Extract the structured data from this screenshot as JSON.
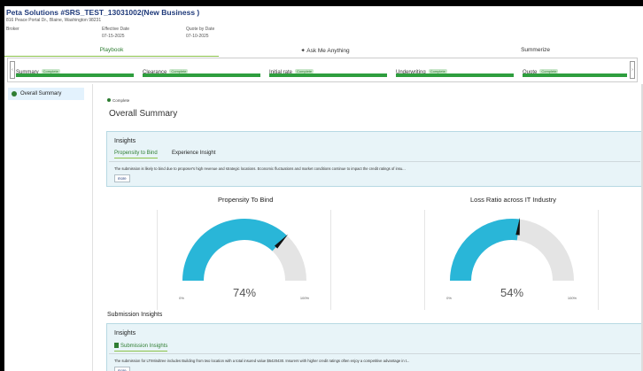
{
  "header": {
    "title": "Peta Solutions #SRS_TEST_13031002(New Business )",
    "address": "816 Peace Portal Dr., Blaine, Washington 98231",
    "broker_label": "Broker",
    "effective_label": "Effective Date",
    "effective_value": "07-15-2025",
    "quote_label": "Quote by Date",
    "quote_value": "07-10-2025"
  },
  "tabs": {
    "playbook": "Playbook",
    "ask": "✦ Ask Me Anything",
    "summarize": "Summerize"
  },
  "stepper": {
    "steps": [
      {
        "name": "Summary",
        "badge": "Complete"
      },
      {
        "name": "Clearance",
        "badge": "Complete"
      },
      {
        "name": "Initial rate",
        "badge": "Complete"
      },
      {
        "name": "Underwriting",
        "badge": "Complete"
      },
      {
        "name": "Quote",
        "badge": "Complete"
      }
    ],
    "accent": "#2e9e3e"
  },
  "sidebar": {
    "items": [
      {
        "label": "Overall Summary"
      }
    ]
  },
  "main": {
    "status": "Complete",
    "title": "Overall Summary",
    "insights1": {
      "title": "Insights",
      "tabs": [
        "Propensity to Bind",
        "Experience Insight"
      ],
      "text": "The submission is likely to bind due to proposer's high revenue  and strategic locations. Economic fluctuations and market conditions continue to impact the credit ratings of insu...",
      "more": "more"
    },
    "gauges": [
      {
        "title": "Propensity  To Bind",
        "value": 74,
        "label": "74%",
        "min": "0%",
        "max": "100%"
      },
      {
        "title": "Loss Ratio across IT Industry",
        "value": 54,
        "label": "54%",
        "min": "0%",
        "max": "100%"
      }
    ],
    "submission_insights": "Submission Insights",
    "insights2": {
      "title": "Insights",
      "tab": "Submission Insights",
      "text": "The submission for LTIMindtree includes Building from two location with a total insured value $5420430. Insurers with higher credit ratings often enjoy a competitive advantage in t...",
      "more": "more"
    }
  },
  "colors": {
    "gauge_fill": "#29b6d8",
    "gauge_track": "#e4e4e4",
    "needle": "#111111"
  }
}
